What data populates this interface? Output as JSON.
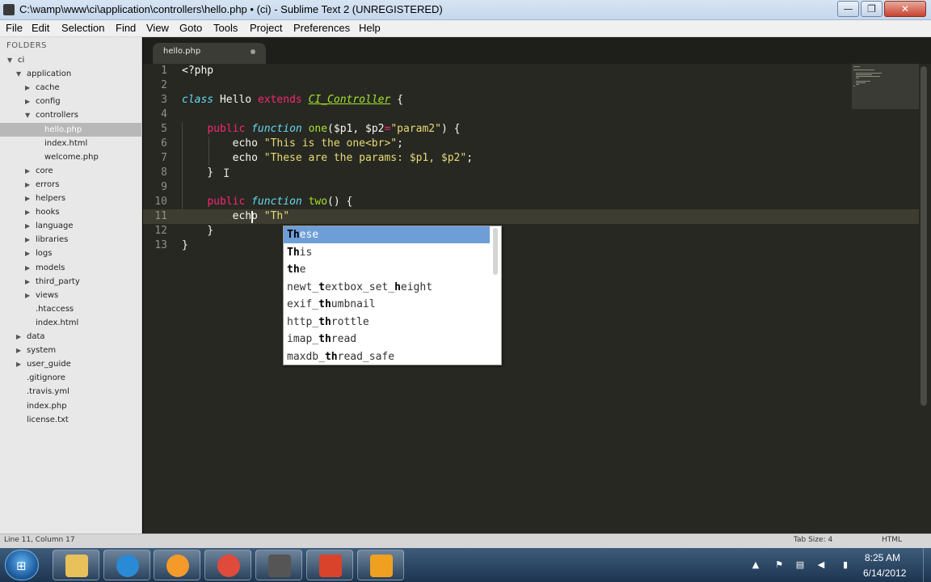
{
  "window": {
    "title": "C:\\wamp\\www\\ci\\application\\controllers\\hello.php • (ci) - Sublime Text 2 (UNREGISTERED)",
    "minimize_symbol": "—",
    "maximize_symbol": "❐",
    "close_symbol": "✕"
  },
  "menu": [
    "File",
    "Edit",
    "Selection",
    "Find",
    "View",
    "Goto",
    "Tools",
    "Project",
    "Preferences",
    "Help"
  ],
  "sidebar": {
    "header": "FOLDERS",
    "tree": [
      {
        "label": "ci",
        "depth": 0,
        "expanded": true,
        "folder": true
      },
      {
        "label": "application",
        "depth": 1,
        "expanded": true,
        "folder": true
      },
      {
        "label": "cache",
        "depth": 2,
        "expanded": false,
        "folder": true
      },
      {
        "label": "config",
        "depth": 2,
        "expanded": false,
        "folder": true
      },
      {
        "label": "controllers",
        "depth": 2,
        "expanded": true,
        "folder": true
      },
      {
        "label": "hello.php",
        "depth": 3,
        "folder": false,
        "selected": true
      },
      {
        "label": "index.html",
        "depth": 3,
        "folder": false
      },
      {
        "label": "welcome.php",
        "depth": 3,
        "folder": false
      },
      {
        "label": "core",
        "depth": 2,
        "expanded": false,
        "folder": true
      },
      {
        "label": "errors",
        "depth": 2,
        "expanded": false,
        "folder": true
      },
      {
        "label": "helpers",
        "depth": 2,
        "expanded": false,
        "folder": true
      },
      {
        "label": "hooks",
        "depth": 2,
        "expanded": false,
        "folder": true
      },
      {
        "label": "language",
        "depth": 2,
        "expanded": false,
        "folder": true
      },
      {
        "label": "libraries",
        "depth": 2,
        "expanded": false,
        "folder": true
      },
      {
        "label": "logs",
        "depth": 2,
        "expanded": false,
        "folder": true
      },
      {
        "label": "models",
        "depth": 2,
        "expanded": false,
        "folder": true
      },
      {
        "label": "third_party",
        "depth": 2,
        "expanded": false,
        "folder": true
      },
      {
        "label": "views",
        "depth": 2,
        "expanded": false,
        "folder": true
      },
      {
        "label": ".htaccess",
        "depth": 2,
        "folder": false
      },
      {
        "label": "index.html",
        "depth": 2,
        "folder": false
      },
      {
        "label": "data",
        "depth": 1,
        "expanded": false,
        "folder": true
      },
      {
        "label": "system",
        "depth": 1,
        "expanded": false,
        "folder": true
      },
      {
        "label": "user_guide",
        "depth": 1,
        "expanded": false,
        "folder": true
      },
      {
        "label": ".gitignore",
        "depth": 1,
        "folder": false
      },
      {
        "label": ".travis.yml",
        "depth": 1,
        "folder": false
      },
      {
        "label": "index.php",
        "depth": 1,
        "folder": false
      },
      {
        "label": "license.txt",
        "depth": 1,
        "folder": false
      }
    ]
  },
  "editor": {
    "tab": {
      "label": "hello.php",
      "modified": true
    },
    "current_line": 11,
    "lines": [
      {
        "n": "1",
        "tokens": [
          [
            "plain",
            "<?php"
          ]
        ]
      },
      {
        "n": "2",
        "tokens": []
      },
      {
        "n": "3",
        "tokens": [
          [
            "kw-class",
            "class"
          ],
          [
            "plain",
            " Hello "
          ],
          [
            "kw-ext",
            "extends"
          ],
          [
            "plain",
            " "
          ],
          [
            "ty",
            "CI_Controller"
          ],
          [
            "plain",
            " {"
          ]
        ]
      },
      {
        "n": "4",
        "tokens": []
      },
      {
        "n": "5",
        "tokens": [
          [
            "plain",
            "    "
          ],
          [
            "kw",
            "public"
          ],
          [
            "plain",
            " "
          ],
          [
            "kw-class",
            "function"
          ],
          [
            "plain",
            " "
          ],
          [
            "fn",
            "one"
          ],
          [
            "plain",
            "($p1, $p2"
          ],
          [
            "op",
            "="
          ],
          [
            "str",
            "\"param2\""
          ],
          [
            "plain",
            ") {"
          ]
        ]
      },
      {
        "n": "6",
        "tokens": [
          [
            "plain",
            "        echo "
          ],
          [
            "str",
            "\"This is the one<br>\""
          ],
          [
            "plain",
            ";"
          ]
        ]
      },
      {
        "n": "7",
        "tokens": [
          [
            "plain",
            "        echo "
          ],
          [
            "str",
            "\"These are the params: $p1, $p2\""
          ],
          [
            "plain",
            ";"
          ]
        ]
      },
      {
        "n": "8",
        "tokens": [
          [
            "plain",
            "    }"
          ]
        ]
      },
      {
        "n": "9",
        "tokens": []
      },
      {
        "n": "10",
        "tokens": [
          [
            "plain",
            "    "
          ],
          [
            "kw",
            "public"
          ],
          [
            "plain",
            " "
          ],
          [
            "kw-class",
            "function"
          ],
          [
            "plain",
            " "
          ],
          [
            "fn",
            "two"
          ],
          [
            "plain",
            "() {"
          ]
        ]
      },
      {
        "n": "11",
        "tokens": [
          [
            "plain",
            "        echo "
          ],
          [
            "str",
            "\"Th\""
          ]
        ]
      },
      {
        "n": "12",
        "tokens": [
          [
            "plain",
            "    }"
          ]
        ]
      },
      {
        "n": "13",
        "tokens": [
          [
            "plain",
            "}"
          ]
        ]
      }
    ]
  },
  "autocomplete": {
    "items": [
      {
        "parts": [
          [
            "b",
            "Th"
          ],
          [
            "",
            "ese"
          ]
        ],
        "selected": true
      },
      {
        "parts": [
          [
            "b",
            "Th"
          ],
          [
            "",
            "is"
          ]
        ]
      },
      {
        "parts": [
          [
            "b",
            "th"
          ],
          [
            "",
            "e"
          ]
        ]
      },
      {
        "parts": [
          [
            "",
            "newt_"
          ],
          [
            "b",
            "t"
          ],
          [
            "",
            "extbox_set_"
          ],
          [
            "b",
            "h"
          ],
          [
            "",
            "eight"
          ]
        ]
      },
      {
        "parts": [
          [
            "",
            "exif_"
          ],
          [
            "b",
            "th"
          ],
          [
            "",
            "umbnail"
          ]
        ]
      },
      {
        "parts": [
          [
            "",
            "http_"
          ],
          [
            "b",
            "th"
          ],
          [
            "",
            "rottle"
          ]
        ]
      },
      {
        "parts": [
          [
            "",
            "imap_"
          ],
          [
            "b",
            "th"
          ],
          [
            "",
            "read"
          ]
        ]
      },
      {
        "parts": [
          [
            "",
            "maxdb_"
          ],
          [
            "b",
            "th"
          ],
          [
            "",
            "read_safe"
          ]
        ]
      }
    ]
  },
  "statusbar": {
    "position": "Line 11, Column 17",
    "tab_size": "Tab Size: 4",
    "syntax": "HTML"
  },
  "taskbar": {
    "apps": [
      "explorer",
      "internet-explorer",
      "media-player",
      "chrome",
      "sublime-text",
      "camtasia",
      "audio-recorder"
    ],
    "app_colors": [
      "#e8c15a",
      "#2a8ad6",
      "#f39a2b",
      "#e04a3a",
      "#555555",
      "#d9432b",
      "#f0a020"
    ],
    "clock_time": "8:25 AM",
    "clock_date": "6/14/2012"
  }
}
